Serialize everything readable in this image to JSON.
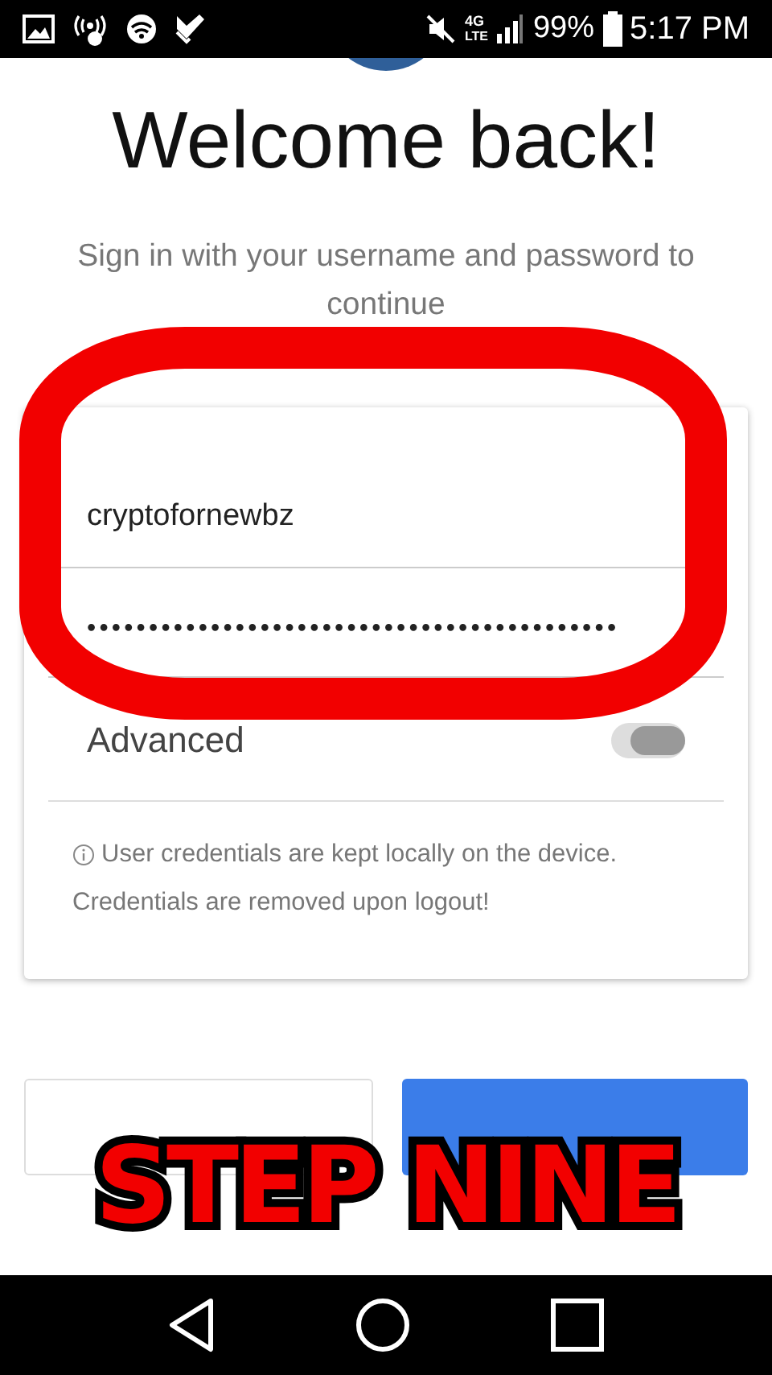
{
  "status_bar": {
    "network": "4G",
    "network_sub": "LTE",
    "battery_text": "99%",
    "time": "5:17 PM"
  },
  "title": "Welcome back!",
  "subtitle": "Sign in with your username and password to continue",
  "form": {
    "username": "cryptofornewbz",
    "password": "•••••••••••••••••••••••••••••••••••••••••••",
    "advanced": {
      "label": "Advanced",
      "on": false
    },
    "notes": [
      {
        "text": "User credentials are kept locally on the device.",
        "info": true
      },
      {
        "text": "Credentials are removed upon logout!",
        "info": false
      }
    ]
  },
  "buttons": [
    {
      "kind": "secondary"
    },
    {
      "kind": "primary"
    }
  ],
  "overlay": {
    "caption": "STEP NINE"
  }
}
